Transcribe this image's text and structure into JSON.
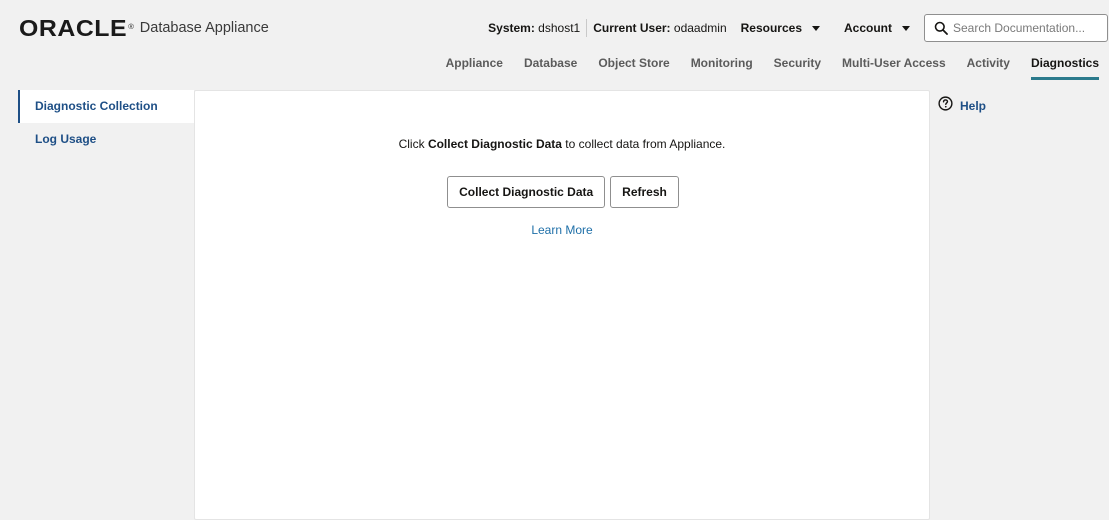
{
  "brand": {
    "logo_text": "ORACLE",
    "registered_mark": "®",
    "product_name": "Database Appliance"
  },
  "header": {
    "system_label": "System:",
    "system_value": "dshost1",
    "user_label": "Current User:",
    "user_value": "odaadmin",
    "resources_menu": "Resources",
    "account_menu": "Account",
    "search_placeholder": "Search Documentation..."
  },
  "nav": {
    "tabs": [
      {
        "label": "Appliance"
      },
      {
        "label": "Database"
      },
      {
        "label": "Object Store"
      },
      {
        "label": "Monitoring"
      },
      {
        "label": "Security"
      },
      {
        "label": "Multi-User Access"
      },
      {
        "label": "Activity"
      },
      {
        "label": "Diagnostics"
      }
    ],
    "active": "Diagnostics"
  },
  "sidebar": {
    "items": [
      {
        "label": "Diagnostic Collection"
      },
      {
        "label": "Log Usage"
      }
    ],
    "active": "Diagnostic Collection"
  },
  "main": {
    "instruction_prefix": "Click ",
    "instruction_bold": "Collect Diagnostic Data",
    "instruction_suffix": " to collect data from Appliance.",
    "collect_button": "Collect Diagnostic Data",
    "refresh_button": "Refresh",
    "learn_more": "Learn More"
  },
  "help": {
    "label": "Help",
    "icon": "question-circle-icon"
  },
  "colors": {
    "background": "#f1f1f1",
    "panel": "#ffffff",
    "link": "#1e4f86",
    "active_tab_underline": "#2b7a8c"
  }
}
